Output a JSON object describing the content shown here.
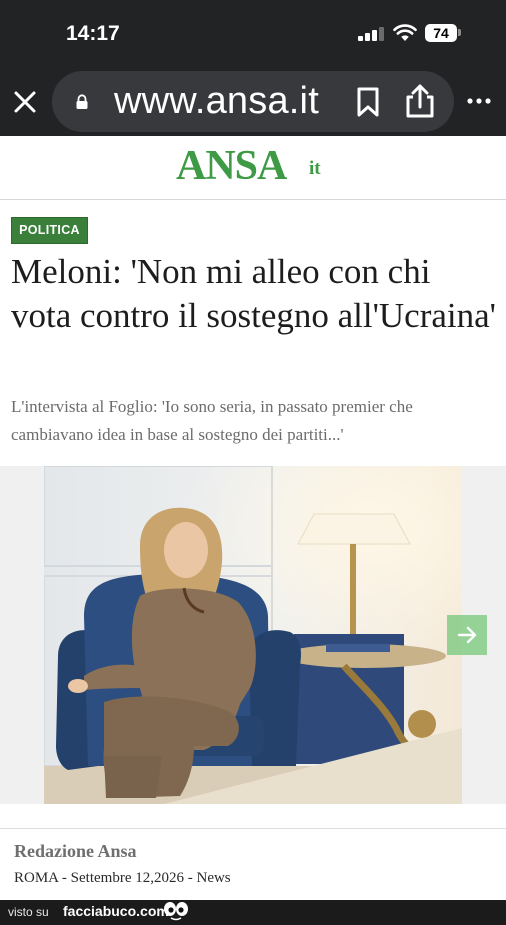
{
  "status_bar": {
    "time": "14:17",
    "battery": "74"
  },
  "browser": {
    "url": "www.ansa.it"
  },
  "site": {
    "logo": "ANSA",
    "logo_suffix": "it"
  },
  "article": {
    "category": "POLITICA",
    "headline": "Meloni: 'Non mi alleo con chi vota contro il sostegno all'Ucraina'",
    "subtitle": "L'intervista al Foglio: 'Io sono seria, in passato premier che cambiavano idea in base al sostegno dei partiti...'",
    "author": "Redazione Ansa",
    "dateline": "ROMA - Settembre 12,2026 - News"
  },
  "watermark": {
    "prefix": "visto su",
    "site": "facciabuco.com"
  },
  "colors": {
    "brand_green": "#3f9a45",
    "category_bg": "#3a7f3a",
    "chrome_bg": "#222325"
  }
}
